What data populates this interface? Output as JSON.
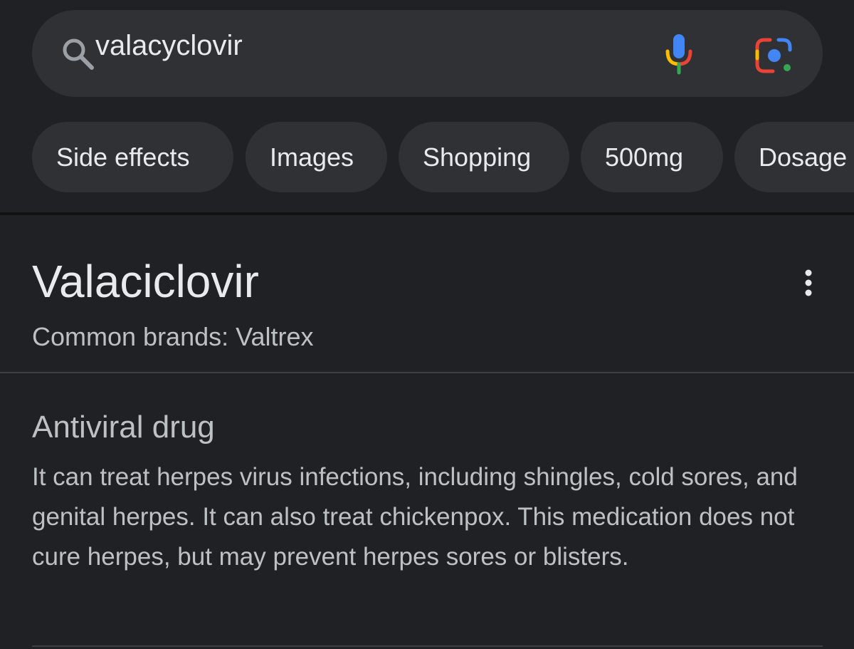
{
  "search": {
    "query": "valacyclovir",
    "search_icon": "search-icon",
    "mic_icon": "microphone-icon",
    "lens_icon": "google-lens-icon"
  },
  "chips": [
    {
      "label": "Side effects"
    },
    {
      "label": "Images"
    },
    {
      "label": "Shopping"
    },
    {
      "label": "500mg"
    },
    {
      "label": "Dosage"
    }
  ],
  "card": {
    "title": "Valaciclovir",
    "subtitle": "Common brands: Valtrex",
    "more_icon": "more-vert-icon",
    "section_heading": "Antiviral drug",
    "description": "It can treat herpes virus infections, including shingles, cold sores, and genital herpes. It can also treat chickenpox. This medication does not cure herpes, but may prevent herpes sores or blisters."
  },
  "colors": {
    "background": "#202124",
    "surface": "#303134",
    "text_primary": "#e8eaed",
    "text_secondary": "#bdc1c6",
    "google_blue": "#4285f4",
    "google_red": "#ea4335",
    "google_yellow": "#fbbc04",
    "google_green": "#34a853"
  }
}
